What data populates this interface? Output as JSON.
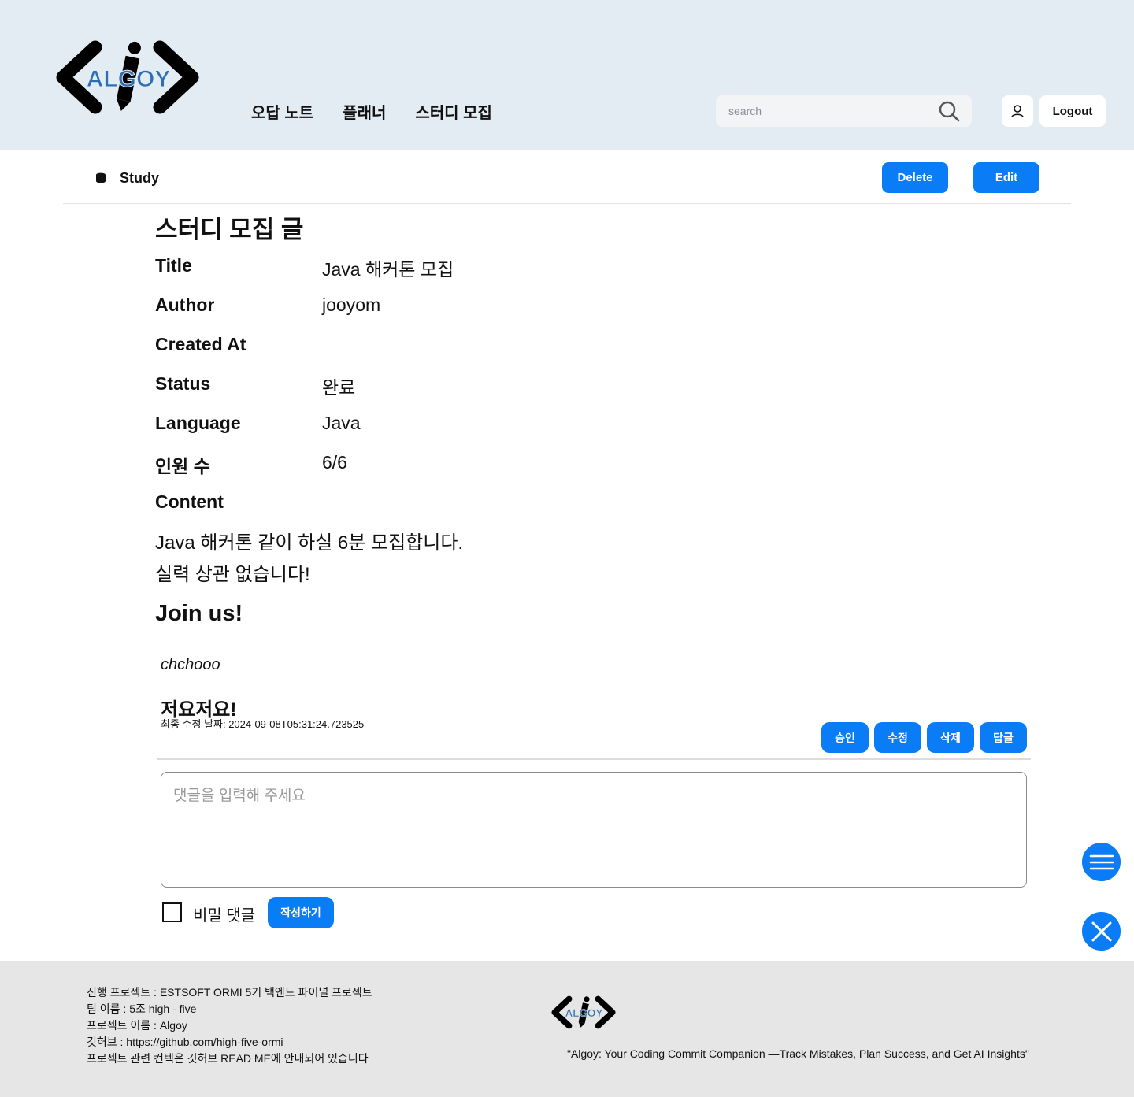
{
  "header": {
    "logo_text": "ALGOY",
    "nav": [
      "오답 노트",
      "플래너",
      "스터디 모집"
    ],
    "search_placeholder": "search",
    "logout_label": "Logout"
  },
  "subbar": {
    "breadcrumb": "Study",
    "delete_label": "Delete",
    "edit_label": "Edit"
  },
  "post": {
    "heading": "스터디 모집 글",
    "fields": [
      {
        "label": "Title",
        "value": "Java 해커톤 모집"
      },
      {
        "label": "Author",
        "value": "jooyom"
      },
      {
        "label": "Created At",
        "value": ""
      },
      {
        "label": "Status",
        "value": "완료"
      },
      {
        "label": "Language",
        "value": "Java"
      },
      {
        "label": "인원 수",
        "value": "6/6"
      }
    ],
    "content_label": "Content",
    "content_lines": [
      "Java 해커톤 같이 하실 6분 모집합니다.",
      "실력 상관 없습니다!"
    ],
    "join_heading": "Join us!"
  },
  "comment": {
    "author": "chchooo",
    "body": "저요저요!",
    "updated": "최종 수정 날짜: 2024-09-08T05:31:24.723525",
    "actions": [
      "승인",
      "수정",
      "삭제",
      "답글"
    ]
  },
  "comment_form": {
    "placeholder": "댓글을 입력해 주세요",
    "secret_label": "비밀 댓글",
    "submit_label": "작성하기"
  },
  "footer": {
    "lines": [
      "진행 프로젝트 : ESTSOFT ORMI 5기 백엔드 파이널 프로젝트",
      "팀 이름 : 5조 high - five",
      "프로젝트 이름 : Algoy",
      "깃허브 : https://github.com/high-five-ormi",
      "프로젝트 관련 컨텍은 깃허브 READ ME에 안내되어 있습니다"
    ],
    "logo_text": "ALGOY",
    "tagline": "\"Algoy: Your Coding Commit Companion —Track Mistakes, Plan Success, and Get AI Insights\""
  },
  "colors": {
    "accent": "#0a7cf5",
    "header_bg": "#e3ebf3",
    "footer_bg": "#e6e6e6"
  },
  "icons": [
    "algoy-logo",
    "search-icon",
    "user-icon",
    "database-icon",
    "menu-icon",
    "close-icon"
  ]
}
